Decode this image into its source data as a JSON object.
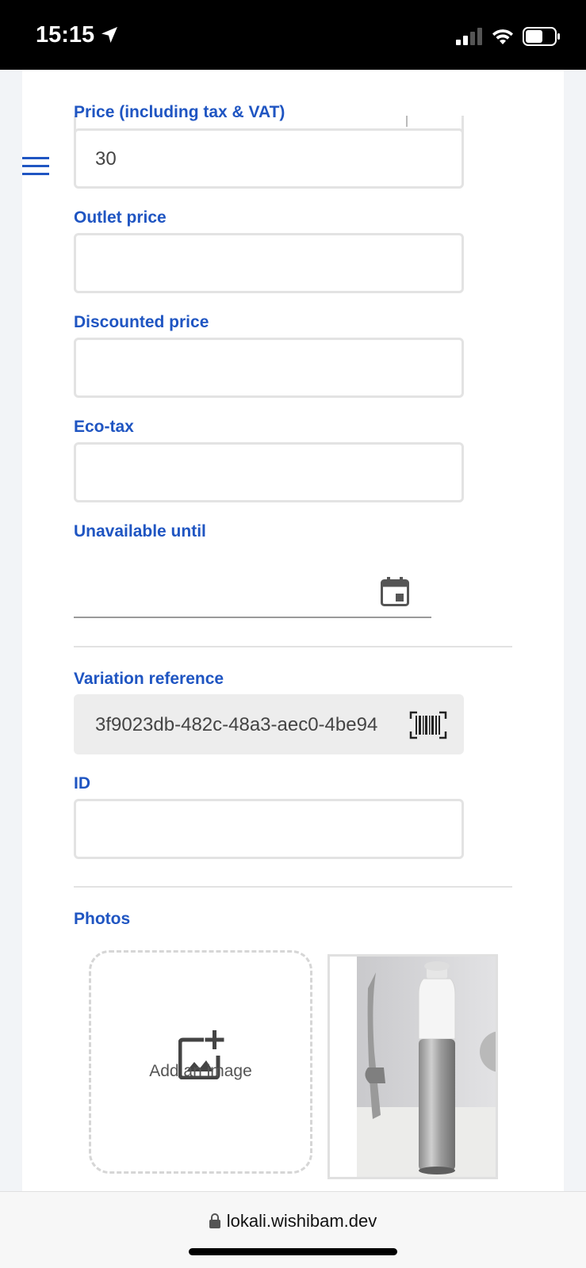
{
  "status_bar": {
    "time": "15:15"
  },
  "form": {
    "price_label": "Price (including tax & VAT)",
    "price_value": "30",
    "outlet_price_label": "Outlet price",
    "outlet_price_value": "",
    "discounted_price_label": "Discounted price",
    "discounted_price_value": "",
    "eco_tax_label": "Eco-tax",
    "eco_tax_value": "",
    "unavailable_until_label": "Unavailable until",
    "unavailable_until_value": "",
    "variation_reference_label": "Variation reference",
    "variation_reference_value": "3f9023db-482c-48a3-aec0-4be94",
    "id_label": "ID",
    "id_value": "",
    "photos_label": "Photos",
    "add_image_label": "Add an image"
  },
  "browser": {
    "url": "lokali.wishibam.dev"
  },
  "colors": {
    "accent": "#1f55c2",
    "status_bar": "#000000"
  },
  "icons": [
    "navigation-arrow-icon",
    "cellular-signal-icon",
    "wifi-icon",
    "battery-icon",
    "hamburger-menu-icon",
    "calendar-icon",
    "barcode-icon",
    "add-photo-icon",
    "lock-icon"
  ]
}
